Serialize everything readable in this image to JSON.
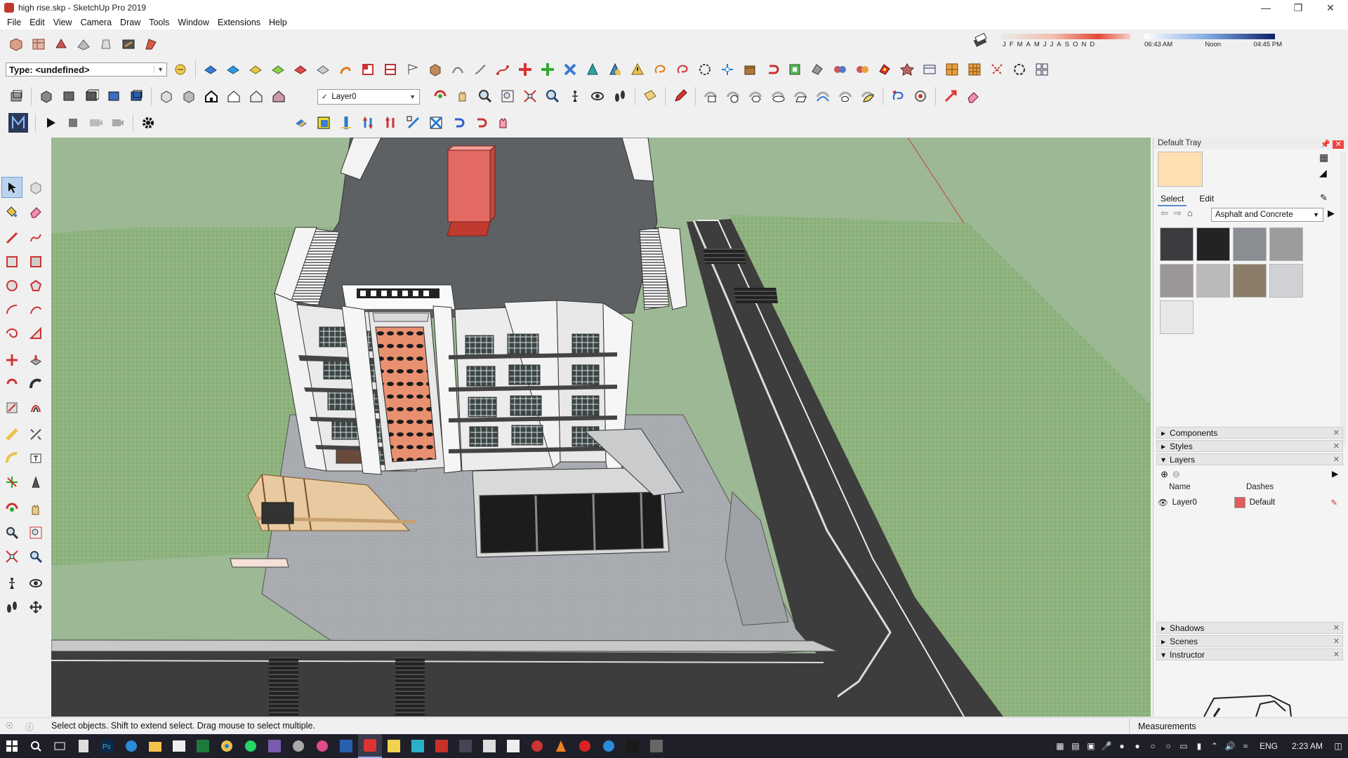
{
  "window": {
    "title": "high rise.skp - SketchUp Pro 2019",
    "controls": [
      "minimize",
      "restore",
      "close"
    ]
  },
  "menu": [
    "File",
    "Edit",
    "View",
    "Camera",
    "Draw",
    "Tools",
    "Window",
    "Extensions",
    "Help"
  ],
  "toolbar": {
    "type_combo": "Type: <undefined>",
    "layer_combo": "Layer0",
    "months": [
      "J",
      "F",
      "M",
      "A",
      "M",
      "J",
      "J",
      "A",
      "S",
      "O",
      "N",
      "D"
    ],
    "time_start": "06:43 AM",
    "time_mid": "Noon",
    "time_end": "04:45 PM"
  },
  "tray": {
    "title": "Default Tray",
    "tabs": [
      "Select",
      "Edit"
    ],
    "material_collection": "Asphalt and Concrete",
    "material_colors": [
      "#3c3c40",
      "#232325",
      "#8a8d91",
      "#9a9c9e",
      "#9b9697",
      "#b9bab9",
      "#8b7d6a",
      "#cfd1d5",
      "#e7e8e9"
    ],
    "panels": {
      "components": "Components",
      "styles": "Styles",
      "layers": "Layers",
      "shadows": "Shadows",
      "scenes": "Scenes",
      "instructor": "Instructor"
    },
    "layers_table": {
      "col_name": "Name",
      "col_dashes": "Dashes",
      "rows": [
        {
          "name": "Layer0",
          "dashes": "Default",
          "color": "#e45b5b"
        }
      ]
    }
  },
  "status": {
    "hint": "Select objects. Shift to extend select. Drag mouse to select multiple.",
    "measurements_label": "Measurements"
  },
  "taskbar": {
    "language": "ENG",
    "clock": "2:23 AM"
  },
  "colors": {
    "grass": "#a7bfa0",
    "roof": "#5a5d60",
    "road": "#3b3b3b",
    "container": "#e26a62"
  }
}
